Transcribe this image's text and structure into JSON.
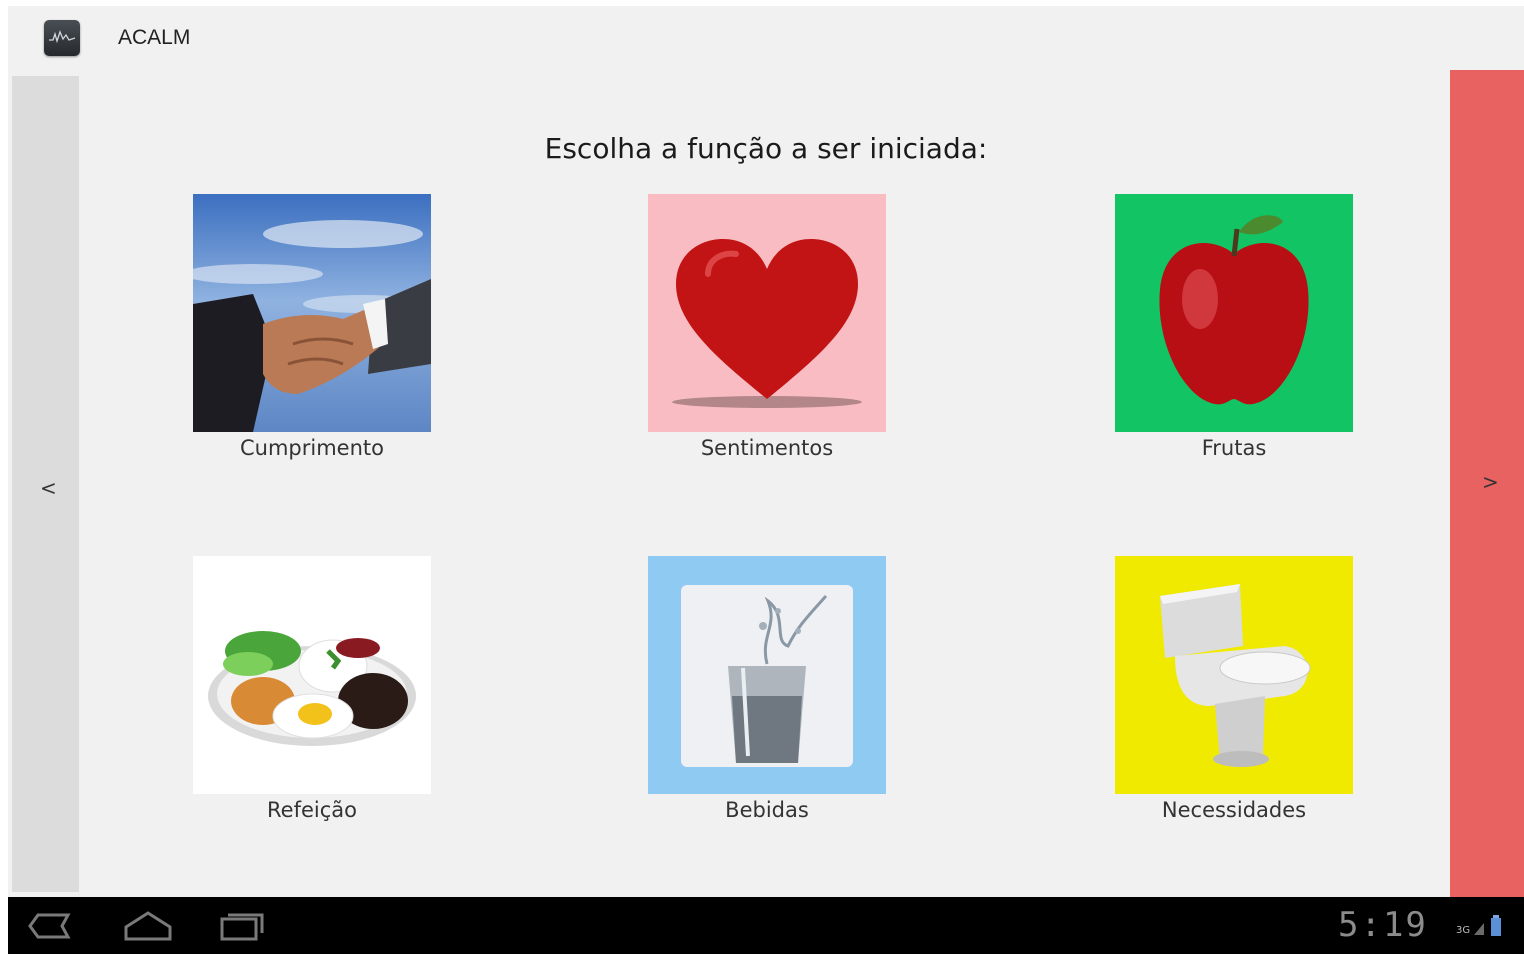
{
  "app": {
    "title": "ACALM",
    "icon": "app-monitor-icon"
  },
  "heading": "Escolha a função a ser iniciada:",
  "nav": {
    "prev_label": "<",
    "next_label": ">"
  },
  "tiles": [
    {
      "label": "Cumprimento",
      "icon": "handshake-icon",
      "bg": "#5b87c6"
    },
    {
      "label": "Sentimentos",
      "icon": "heart-icon",
      "bg": "#f9bcc3"
    },
    {
      "label": "Frutas",
      "icon": "apple-icon",
      "bg": "#12c463"
    },
    {
      "label": "Refeição",
      "icon": "meal-plate-icon",
      "bg": "#ffffff"
    },
    {
      "label": "Bebidas",
      "icon": "water-glass-icon",
      "bg": "#8fcaf3"
    },
    {
      "label": "Necessidades",
      "icon": "toilet-icon",
      "bg": "#f0ea00"
    }
  ],
  "system_bar": {
    "time": "5:19",
    "network": "3G"
  },
  "colors": {
    "right_panel": "#e86262",
    "left_panel": "#dcdcdc",
    "background": "#f1f1f1"
  }
}
